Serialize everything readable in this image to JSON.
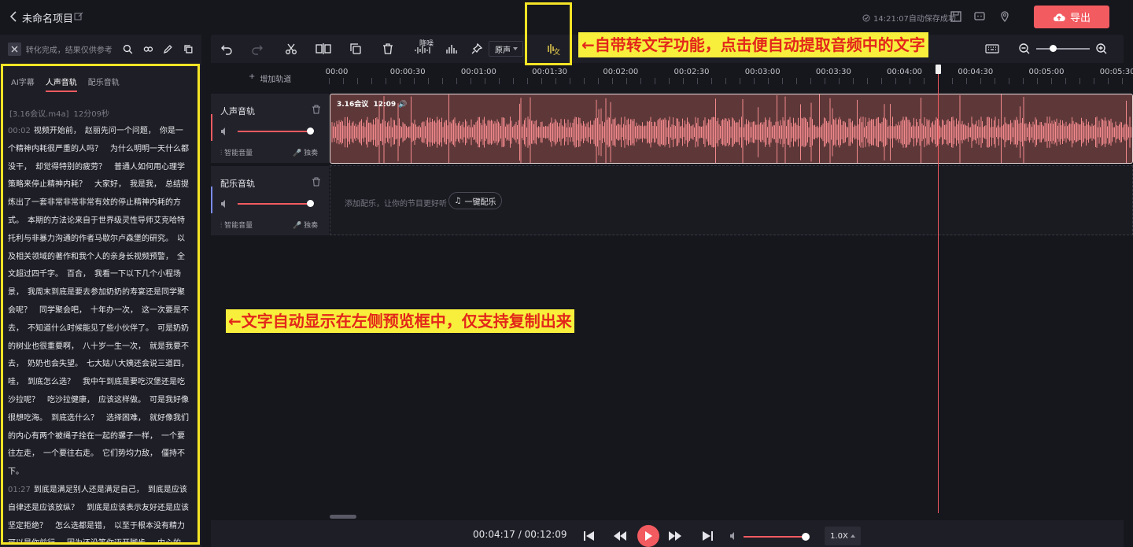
{
  "header": {
    "title": "未命名项目",
    "autosave": "14:21:07自动保存成功",
    "export_label": "导出"
  },
  "left_panel": {
    "conversion_note": "转化完成，结果仅供参考",
    "tabs": [
      "AI字幕",
      "人声音轨",
      "配乐音轨"
    ],
    "active_tab": "人声音轨",
    "file_name": "[3.16会议.m4a]",
    "file_duration": "12分09秒",
    "transcript": [
      {
        "time": "00:02",
        "text": "视频开始前，　赵丽先问一个问题，　你是一个精神内耗很严重的人吗？　为什么明明一天什么都没干，　却觉得特别的疲劳？　普通人如何用心理学策略来停止精神内耗？　大家好，　我是我，　总结提炼出了一套非常非常非常有效的停止精神内耗的方式。　本期的方法论来自于世界级灵性导师艾克哈特托利与非暴力沟通的作者马歇尔卢森堡的研究。　以及相关领域的著作和我个人的亲身长视频预警，　全文超过四千字。　百合，　我看一下以下几个小程场景，　我周末到底是要去参加奶奶的寿宴还是同学聚会呢？　同学聚会吧，　十年办一次，　这一次要是不去，　不知道什么时候能见了些小伙伴了。　可是奶奶的树业也很重要啊，　八十岁一生一次，　就是我要不去，　奶奶也会失望。　七大姑八大姨还会说三道四，　哇，　到底怎么选？　我中午到底是要吃汉堡还是吃沙拉呢？　吃沙拉健康，　应该这样做。　可是我好像很想吃海。　到底选什么？　选择困难，　就好像我们的内心有两个被绳子拴在一起的骡子一样，　一个要往左走，　一个要往右走。　它们势均力敌，　僵持不下。"
      },
      {
        "time": "01:27",
        "text": "到底是满足别人还是满足自己，　到底是应该自律还是应该放纵？　到底是应该表示友好还是应该坚定拒绝？　怎么选都是错，　以至于根本没有精力可以是你前行，　因为还没等你迈开脚步，　内心的"
      }
    ]
  },
  "toolbar": {
    "denoise_label": "降噪",
    "original_sound": "原声",
    "annotation_top": "←自带转文字功能，点击便自动提取音频中的文字",
    "annotation_mid": "←文字自动显示在左侧预览框中，仅支持复制出来"
  },
  "timeline": {
    "add_track": "增加轨道",
    "ruler": [
      "00:00",
      "00:00:30",
      "00:01:00",
      "00:01:30",
      "00:02:00",
      "00:02:30",
      "00:03:00",
      "00:03:30",
      "00:04:00",
      "00:04:30",
      "00:05:00",
      "00:05:30"
    ],
    "voice_track": {
      "name": "人声音轨",
      "smart_volume": "智能音量",
      "solo": "独奏",
      "clip_name": "3.16会议",
      "clip_duration": "12:09"
    },
    "music_track": {
      "name": "配乐音轨",
      "smart_volume": "智能音量",
      "solo": "独奏",
      "hint": "添加配乐，让你的节目更好听",
      "one_key": "一键配乐"
    }
  },
  "playback": {
    "current": "00:04:17",
    "total": "00:12:09",
    "speed": "1.0X",
    "progress": 0.352
  },
  "colors": {
    "accent": "#f25b60",
    "highlight": "#f5e425"
  }
}
